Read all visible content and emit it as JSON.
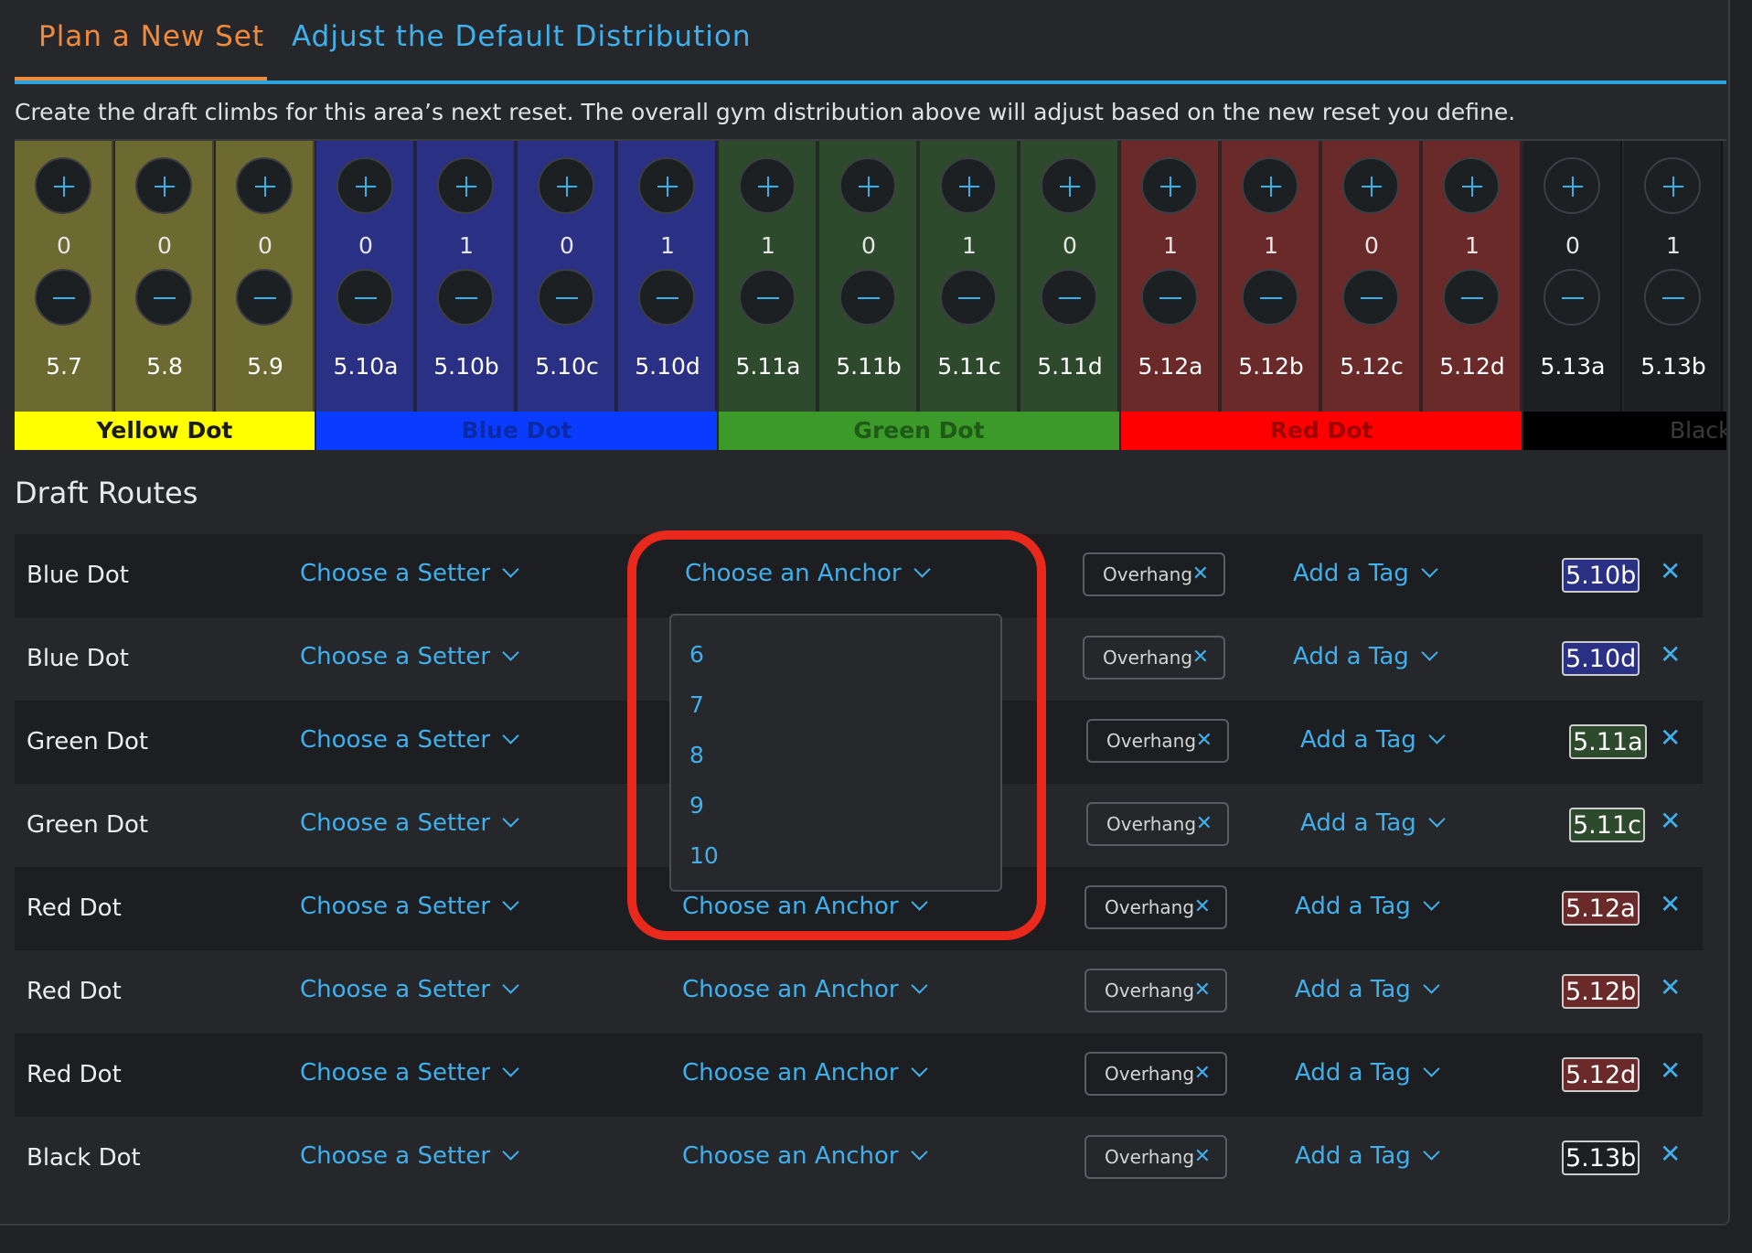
{
  "tabs": {
    "plan": "Plan a New Set",
    "adjust": "Adjust the Default Distribution"
  },
  "intro": "Create the draft climbs for this area’s next reset. The overall gym distribution above will adjust based on the new reset you define.",
  "grades": [
    {
      "label": "5.7",
      "count": "0",
      "color": "#6c6a30"
    },
    {
      "label": "5.8",
      "count": "0",
      "color": "#6c6a30"
    },
    {
      "label": "5.9",
      "count": "0",
      "color": "#6c6a30"
    },
    {
      "label": "5.10a",
      "count": "0",
      "color": "#2a3084"
    },
    {
      "label": "5.10b",
      "count": "1",
      "color": "#2a3084"
    },
    {
      "label": "5.10c",
      "count": "0",
      "color": "#2a3084"
    },
    {
      "label": "5.10d",
      "count": "1",
      "color": "#2a3084"
    },
    {
      "label": "5.11a",
      "count": "1",
      "color": "#2e4a2c"
    },
    {
      "label": "5.11b",
      "count": "0",
      "color": "#2e4a2c"
    },
    {
      "label": "5.11c",
      "count": "1",
      "color": "#2e4a2c"
    },
    {
      "label": "5.11d",
      "count": "0",
      "color": "#2e4a2c"
    },
    {
      "label": "5.12a",
      "count": "1",
      "color": "#6a2a2a"
    },
    {
      "label": "5.12b",
      "count": "1",
      "color": "#6a2a2a"
    },
    {
      "label": "5.12c",
      "count": "0",
      "color": "#6a2a2a"
    },
    {
      "label": "5.12d",
      "count": "1",
      "color": "#6a2a2a"
    },
    {
      "label": "5.13a",
      "count": "0",
      "color": "#1d1f22"
    },
    {
      "label": "5.13b",
      "count": "1",
      "color": "#1d1f22"
    }
  ],
  "bands": [
    {
      "label": "Yellow Dot",
      "color": "#ffff00",
      "text": "#1a1a1a"
    },
    {
      "label": "Blue Dot",
      "color": "#0a3cff",
      "text": "#0b2aa8"
    },
    {
      "label": "Green Dot",
      "color": "#3b9a2a",
      "text": "#1f5a16"
    },
    {
      "label": "Red Dot",
      "color": "#ff0000",
      "text": "#a00000"
    },
    {
      "label": "Black Dot",
      "color": "#000000",
      "text": "#3a3a3a"
    }
  ],
  "draft_title": "Draft Routes",
  "setter_label": "Choose a Setter",
  "anchor_label": "Choose an Anchor",
  "add_tag_label": "Add a Tag",
  "routes": [
    {
      "name": "Blue Dot",
      "tag": "Overhang",
      "grade": "5.10b",
      "grade_color": "#2a3084"
    },
    {
      "name": "Blue Dot",
      "tag": "Overhang",
      "grade": "5.10d",
      "grade_color": "#2a3084"
    },
    {
      "name": "Green Dot",
      "tag": "Overhang",
      "grade": "5.11a",
      "grade_color": "#2e4a2c"
    },
    {
      "name": "Green Dot",
      "tag": "Overhang",
      "grade": "5.11c",
      "grade_color": "#2e4a2c"
    },
    {
      "name": "Red Dot",
      "tag": "Overhang",
      "grade": "5.12a",
      "grade_color": "#6a2a2a"
    },
    {
      "name": "Red Dot",
      "tag": "Overhang",
      "grade": "5.12b",
      "grade_color": "#6a2a2a"
    },
    {
      "name": "Red Dot",
      "tag": "Overhang",
      "grade": "5.12d",
      "grade_color": "#6a2a2a"
    },
    {
      "name": "Black Dot",
      "tag": "Overhang",
      "grade": "5.13b",
      "grade_color": "#1d1f22"
    }
  ],
  "anchor_options": [
    "6",
    "7",
    "8",
    "9",
    "10"
  ],
  "tag_remove_glyph": "✕",
  "row_remove_glyph": "✕"
}
